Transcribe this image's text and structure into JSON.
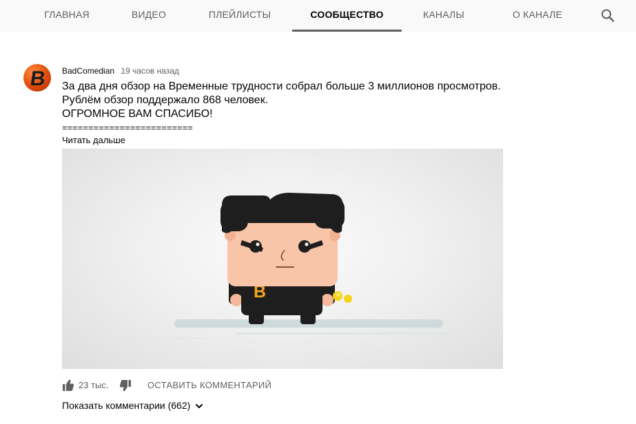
{
  "tabs": [
    {
      "label": "ГЛАВНАЯ",
      "active": false
    },
    {
      "label": "ВИДЕО",
      "active": false
    },
    {
      "label": "ПЛЕЙЛИСТЫ",
      "active": false
    },
    {
      "label": "СООБЩЕСТВО",
      "active": true
    },
    {
      "label": "КАНАЛЫ",
      "active": false
    },
    {
      "label": "О КАНАЛЕ",
      "active": false
    }
  ],
  "icons": {
    "search": "search-icon",
    "like": "thumbs-up-icon",
    "dislike": "thumbs-down-icon",
    "expand": "chevron-down-icon"
  },
  "post": {
    "author": "BadComedian",
    "time": "19 часов назад",
    "avatar_letter": "B",
    "lines": [
      "За два дня обзор на Временные трудности собрал больше 3 миллионов просмотров.",
      "Рублём обзор поддержало 868 человек.",
      "ОГРОМНОЕ ВАМ СПАСИБО!",
      "========================="
    ],
    "read_more": "Читать дальше",
    "image_shirt_letter": "B",
    "likes": "23 тыс.",
    "comment_button": "ОСТАВИТЬ КОММЕНТАРИЙ",
    "show_comments": "Показать комментарии (662)"
  },
  "colors": {
    "tabbar_bg": "#f9f9f9",
    "text_secondary": "#606060",
    "avatar_orange": "#e04a0a",
    "shirt_letter": "#f5a623"
  }
}
